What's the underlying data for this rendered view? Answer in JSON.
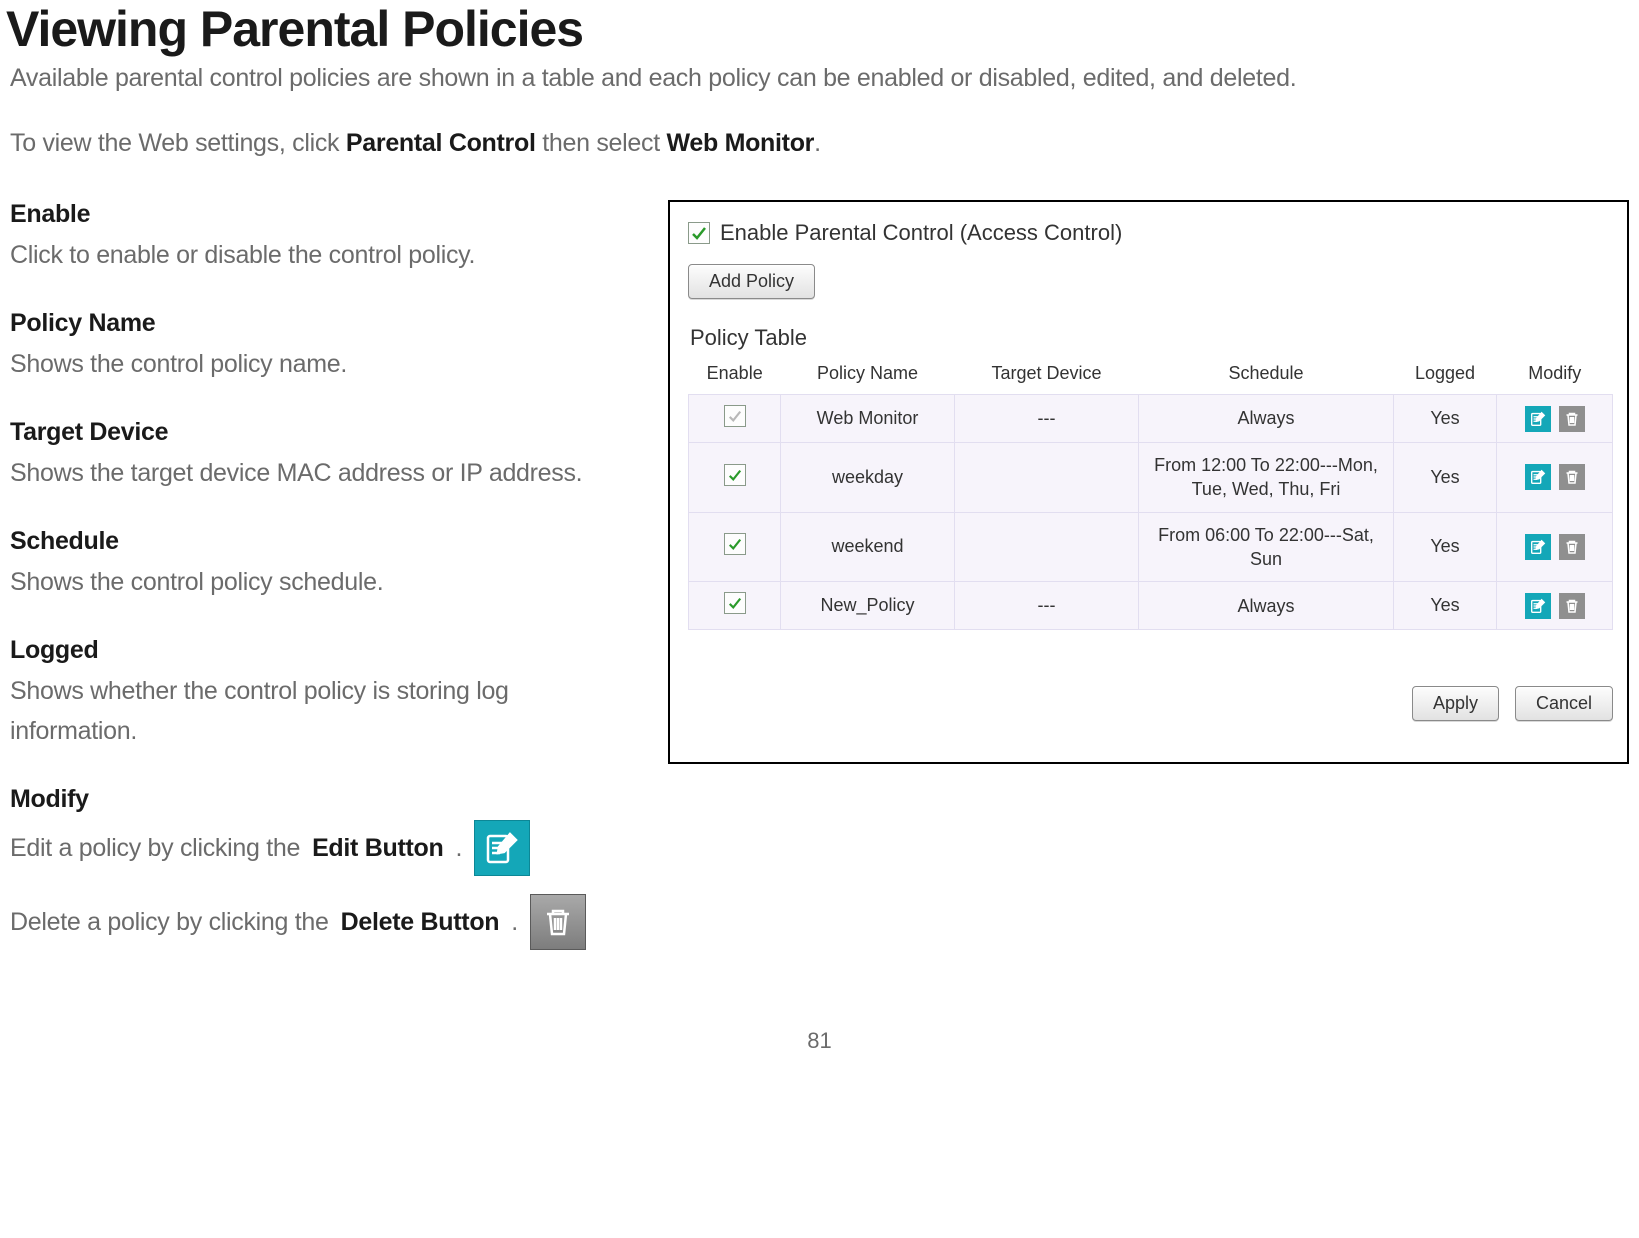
{
  "page": {
    "title": "Viewing Parental Policies",
    "intro": "Available parental control policies are shown in a table and each policy can be enabled or disabled, edited, and deleted.",
    "nav_pre": "To view the Web settings, click ",
    "nav_b1": "Parental Control",
    "nav_mid": " then select ",
    "nav_b2": "Web Monitor",
    "nav_post": ".",
    "page_number": "81"
  },
  "defs": {
    "enable": {
      "term": "Enable",
      "desc": "Click to enable or disable the control policy."
    },
    "policy_name": {
      "term": "Policy Name",
      "desc": "Shows the control policy name."
    },
    "target_device": {
      "term": "Target Device",
      "desc": "Shows the target device MAC address or IP address."
    },
    "schedule": {
      "term": "Schedule",
      "desc": "Shows the control policy schedule."
    },
    "logged": {
      "term": "Logged",
      "desc": "Shows whether the control policy is storing log information."
    },
    "modify": {
      "term": "Modify",
      "edit_pre": "Edit a policy by clicking the ",
      "edit_b": "Edit Button",
      "edit_post": ".",
      "delete_pre": "Delete a policy by clicking the ",
      "delete_b": "Delete Button",
      "delete_post": "."
    }
  },
  "panel": {
    "checkbox_label": "Enable Parental Control (Access Control)",
    "add_policy": "Add Policy",
    "table_caption": "Policy Table",
    "columns": {
      "c0": "Enable",
      "c1": "Policy Name",
      "c2": "Target Device",
      "c3": "Schedule",
      "c4": "Logged",
      "c5": "Modify"
    },
    "rows": [
      {
        "enabled": "gray",
        "name": "Web Monitor",
        "device": "---",
        "schedule": "Always",
        "logged": "Yes"
      },
      {
        "enabled": "green",
        "name": "weekday",
        "device": "",
        "schedule": "From 12:00 To 22:00---Mon, Tue, Wed, Thu, Fri",
        "logged": "Yes"
      },
      {
        "enabled": "green",
        "name": "weekend",
        "device": "",
        "schedule": "From 06:00 To 22:00---Sat, Sun",
        "logged": "Yes"
      },
      {
        "enabled": "green",
        "name": "New_Policy",
        "device": "---",
        "schedule": "Always",
        "logged": "Yes"
      }
    ],
    "apply": "Apply",
    "cancel": "Cancel"
  }
}
